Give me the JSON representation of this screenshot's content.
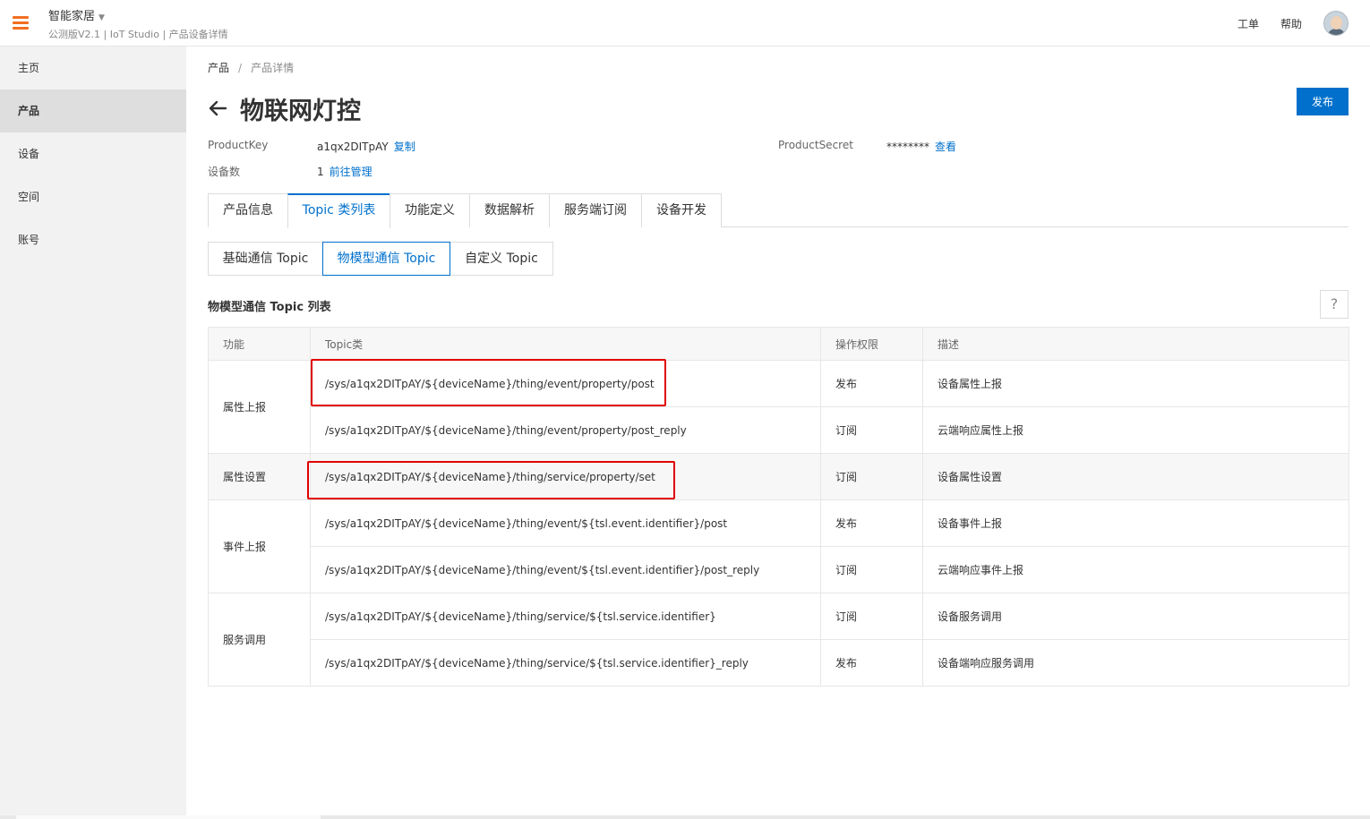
{
  "header": {
    "app_name": "智能家居",
    "subtitle": "公测版V2.1 | IoT Studio | 产品设备详情",
    "links": [
      "工单",
      "帮助"
    ]
  },
  "sidebar": {
    "items": [
      {
        "label": "主页",
        "active": false
      },
      {
        "label": "产品",
        "active": true
      },
      {
        "label": "设备",
        "active": false
      },
      {
        "label": "空间",
        "active": false
      },
      {
        "label": "账号",
        "active": false
      }
    ]
  },
  "breadcrumb": {
    "root": "产品",
    "separator": "/",
    "current": "产品详情"
  },
  "page": {
    "title": "物联网灯控",
    "publish_label": "发布"
  },
  "meta": {
    "product_key_label": "ProductKey",
    "product_key_value": "a1qx2DITpAY",
    "copy_label": "复制",
    "device_count_label": "设备数",
    "device_count_value": "1",
    "manage_label": "前往管理",
    "product_secret_label": "ProductSecret",
    "product_secret_value": "********",
    "view_label": "查看"
  },
  "tabs": {
    "items": [
      "产品信息",
      "Topic 类列表",
      "功能定义",
      "数据解析",
      "服务端订阅",
      "设备开发"
    ],
    "active_index": 1
  },
  "subtabs": {
    "items": [
      "基础通信 Topic",
      "物模型通信 Topic",
      "自定义 Topic"
    ],
    "active_index": 1
  },
  "section": {
    "title": "物模型通信 Topic 列表",
    "help": "?"
  },
  "table": {
    "columns": [
      "功能",
      "Topic类",
      "操作权限",
      "描述"
    ],
    "groups": [
      {
        "function": "属性上报",
        "rows": [
          {
            "topic": "/sys/a1qx2DITpAY/${deviceName}/thing/event/property/post",
            "perm": "发布",
            "desc": "设备属性上报"
          },
          {
            "topic": "/sys/a1qx2DITpAY/${deviceName}/thing/event/property/post_reply",
            "perm": "订阅",
            "desc": "云端响应属性上报"
          }
        ]
      },
      {
        "function": "属性设置",
        "rows": [
          {
            "topic": "/sys/a1qx2DITpAY/${deviceName}/thing/service/property/set",
            "perm": "订阅",
            "desc": "设备属性设置"
          }
        ]
      },
      {
        "function": "事件上报",
        "rows": [
          {
            "topic": "/sys/a1qx2DITpAY/${deviceName}/thing/event/${tsl.event.identifier}/post",
            "perm": "发布",
            "desc": "设备事件上报"
          },
          {
            "topic": "/sys/a1qx2DITpAY/${deviceName}/thing/event/${tsl.event.identifier}/post_reply",
            "perm": "订阅",
            "desc": "云端响应事件上报"
          }
        ]
      },
      {
        "function": "服务调用",
        "rows": [
          {
            "topic": "/sys/a1qx2DITpAY/${deviceName}/thing/service/${tsl.service.identifier}",
            "perm": "订阅",
            "desc": "设备服务调用"
          },
          {
            "topic": "/sys/a1qx2DITpAY/${deviceName}/thing/service/${tsl.service.identifier}_reply",
            "perm": "发布",
            "desc": "设备端响应服务调用"
          }
        ]
      }
    ]
  },
  "colors": {
    "primary": "#0070cc",
    "accent": "#f26f21",
    "highlight": "#e00000"
  }
}
